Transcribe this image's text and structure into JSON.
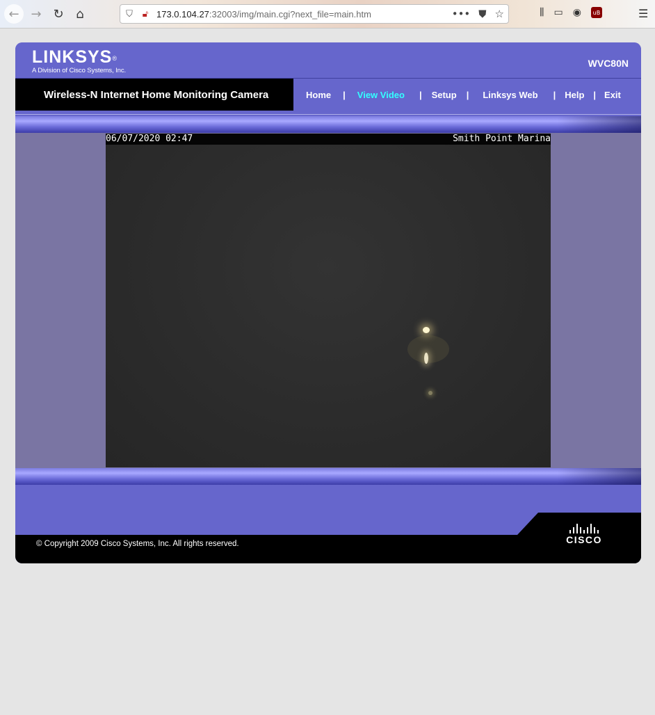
{
  "browser": {
    "url_host": "173.0.104.27",
    "url_rest": ":32003/img/main.cgi?next_file=main.htm"
  },
  "header": {
    "logo_text": "LINKSYS",
    "logo_sub": "A Division of Cisco Systems, Inc.",
    "model": "WVC80N"
  },
  "titlebar": {
    "product_title": "Wireless-N Internet Home Monitoring Camera"
  },
  "nav": {
    "items": [
      "Home",
      "View Video",
      "Setup",
      "Linksys Web",
      "Help",
      "Exit"
    ],
    "active": "View Video"
  },
  "video": {
    "timestamp": "06/07/2020 02:47",
    "location": "Smith Point Marina"
  },
  "footer": {
    "copyright": "© Copyright 2009 Cisco Systems, Inc. All rights reserved.",
    "cisco_logo_text": "CISCO"
  },
  "colors": {
    "brand_purple": "#6666cc",
    "active_nav": "#33ffff",
    "background": "#e5e5e5"
  }
}
